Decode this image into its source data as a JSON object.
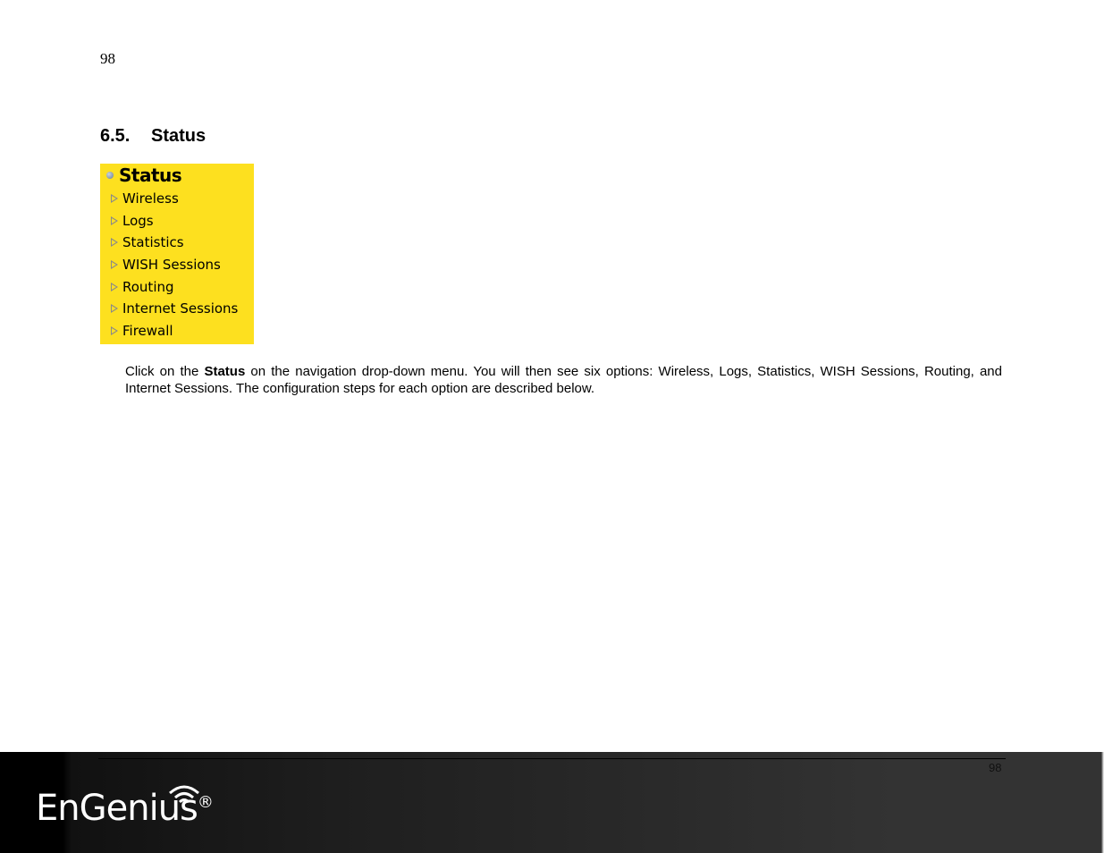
{
  "page": {
    "number_top": "98",
    "number_footer": "98"
  },
  "section": {
    "number": "6.5.",
    "title": "Status"
  },
  "menu": {
    "title": "Status",
    "items": [
      {
        "label": "Wireless"
      },
      {
        "label": "Logs"
      },
      {
        "label": "Statistics"
      },
      {
        "label": "WISH Sessions"
      },
      {
        "label": "Routing"
      },
      {
        "label": "Internet Sessions"
      },
      {
        "label": "Firewall"
      }
    ],
    "background_color": "#fde01f"
  },
  "body": {
    "text_before": "Click on the ",
    "bold": "Status",
    "text_after": " on the navigation drop-down menu. You will then see six options: Wireless, Logs, Statistics, WISH Sessions, Routing, and Internet Sessions. The configuration steps for each option are described below."
  },
  "footer": {
    "brand": "EnGenius",
    "registered_mark": "®"
  }
}
